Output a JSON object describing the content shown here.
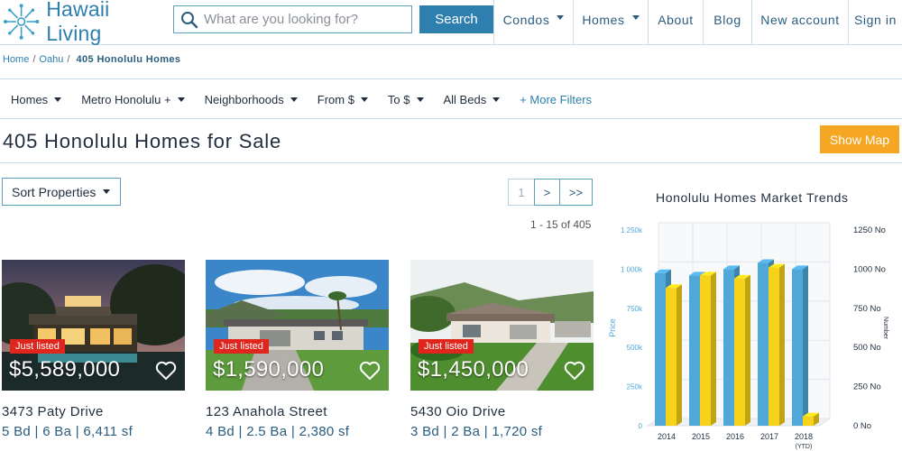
{
  "brand": {
    "name": "Hawaii Living"
  },
  "search": {
    "placeholder": "What are you looking for?",
    "button_label": "Search"
  },
  "nav": {
    "items": [
      {
        "label": "Condos",
        "dropdown": true
      },
      {
        "label": "Homes",
        "dropdown": true
      },
      {
        "label": "About",
        "dropdown": false
      },
      {
        "label": "Blog",
        "dropdown": false
      },
      {
        "label": "New account",
        "dropdown": false
      },
      {
        "label": "Sign in",
        "dropdown": false
      }
    ]
  },
  "breadcrumb": {
    "home": "Home",
    "area": "Oahu",
    "current": "405 Honolulu Homes"
  },
  "filters": {
    "items": [
      "Homes",
      "Metro Honolulu +",
      "Neighborhoods",
      "From $",
      "To $",
      "All Beds"
    ],
    "more_label": "+ More Filters"
  },
  "page": {
    "title": "405 Honolulu Homes for Sale",
    "map_button": "Show Map",
    "sort_label": "Sort Properties",
    "pager": {
      "current": "1",
      "next": ">",
      "last": ">>"
    },
    "result_count": "1 - 15 of 405"
  },
  "listings": [
    {
      "badge": "Just listed",
      "price": "$5,589,000",
      "address": "3473 Paty Drive",
      "specs": "5 Bd | 6 Ba | 6,411 sf"
    },
    {
      "badge": "Just listed",
      "price": "$1,590,000",
      "address": "123 Anahola Street",
      "specs": "4 Bd | 2.5 Ba | 2,380 sf"
    },
    {
      "badge": "Just listed",
      "price": "$1,450,000",
      "address": "5430 Oio Drive",
      "specs": "3 Bd | 2 Ba | 1,720 sf"
    }
  ],
  "chart_data": {
    "type": "bar",
    "title": "Honolulu Homes Market Trends",
    "categories": [
      "2014",
      "2015",
      "2016",
      "2017",
      "2018"
    ],
    "category_sublabel": "(YTD)",
    "y_left": {
      "label": "Price",
      "ticks": [
        "0",
        "250k",
        "500k",
        "750k",
        "1 000k",
        "1 250k"
      ],
      "range": [
        0,
        1250000
      ]
    },
    "y_right": {
      "label": "Number",
      "ticks": [
        "0 No",
        "250 No",
        "500 No",
        "750 No",
        "1000 No",
        "1250 No"
      ],
      "range": [
        0,
        1250
      ]
    },
    "series": [
      {
        "axis": "left",
        "color": "#4fa8d8",
        "values": [
          975000,
          960000,
          1000000,
          1040000,
          1000000
        ]
      },
      {
        "axis": "right",
        "color": "#f7d21a",
        "values": [
          880,
          960,
          940,
          1010,
          60
        ]
      }
    ],
    "style": "3d",
    "grid": true
  }
}
